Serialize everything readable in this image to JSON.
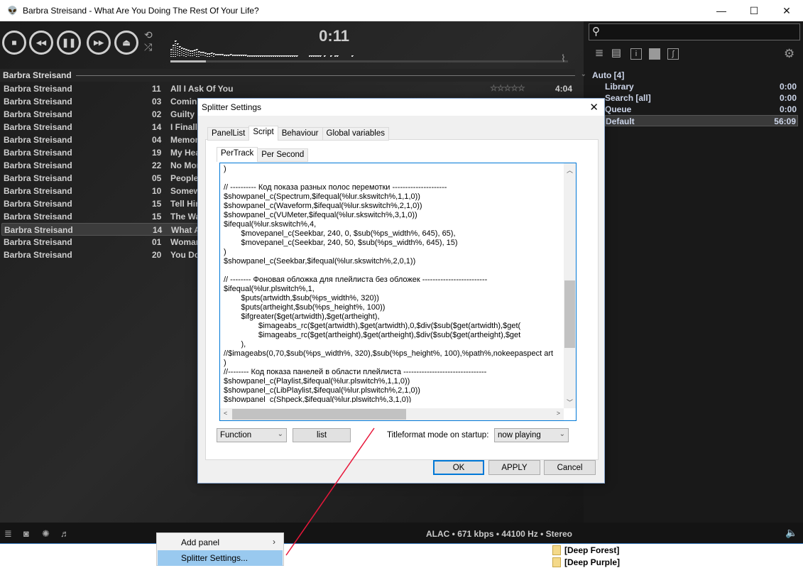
{
  "window": {
    "title": "Barbra Streisand - What Are You Doing The Rest Of Your Life?",
    "minimize": "—",
    "maximize": "☐",
    "close": "✕"
  },
  "transport": {
    "stop": "■",
    "prev": "◀◀",
    "pause": "❚❚",
    "next": "▶▶",
    "eject": "⏏",
    "repeat": "⟲",
    "shuffle": "⤮",
    "time": "0:11",
    "seek_progress": 0.09
  },
  "playlist": {
    "group": "Barbra Streisand",
    "rows": [
      {
        "artist": "Barbra Streisand",
        "num": "11",
        "title": "All I Ask Of You",
        "rating": "☆☆☆☆☆",
        "duration": "4:04"
      },
      {
        "artist": "Barbra Streisand",
        "num": "03",
        "title": "Comin'"
      },
      {
        "artist": "Barbra Streisand",
        "num": "02",
        "title": "Guilty ("
      },
      {
        "artist": "Barbra Streisand",
        "num": "14",
        "title": "I Finall"
      },
      {
        "artist": "Barbra Streisand",
        "num": "04",
        "title": "Memor"
      },
      {
        "artist": "Barbra Streisand",
        "num": "19",
        "title": "My Hea"
      },
      {
        "artist": "Barbra Streisand",
        "num": "22",
        "title": "No Mor"
      },
      {
        "artist": "Barbra Streisand",
        "num": "05",
        "title": "People"
      },
      {
        "artist": "Barbra Streisand",
        "num": "10",
        "title": "Somew"
      },
      {
        "artist": "Barbra Streisand",
        "num": "15",
        "title": "Tell Hir"
      },
      {
        "artist": "Barbra Streisand",
        "num": "15",
        "title": "The Wa"
      },
      {
        "artist": "Barbra Streisand",
        "num": "14",
        "title": "What A"
      },
      {
        "artist": "Barbra Streisand",
        "num": "01",
        "title": "Woman"
      },
      {
        "artist": "Barbra Streisand",
        "num": "20",
        "title": "You Do"
      }
    ]
  },
  "right_panel": {
    "search_icon": "⚲",
    "tree_root": "Auto [4]",
    "items": [
      {
        "name": "Library",
        "time": "0:00"
      },
      {
        "name": "Search [all]",
        "time": "0:00"
      },
      {
        "name": "Queue",
        "time": "0:00"
      },
      {
        "name": "Default",
        "time": "56:09"
      }
    ]
  },
  "statusbar": {
    "text": "ALAC • 671 kbps • 44100 Hz • Stereo"
  },
  "folders": [
    "[Deep Forest]",
    "[Deep Purple]"
  ],
  "dialog": {
    "title": "Splitter Settings",
    "tabs": [
      "PanelList",
      "Script",
      "Behaviour",
      "Global variables"
    ],
    "inner_tabs": [
      "PerTrack",
      "Per Second"
    ],
    "code": ")\n\n// ---------- Код показа разных полос перемотки ---------------------\n$showpanel_c(Spectrum,$ifequal(%lur.skswitch%,1,1,0))\n$showpanel_c(Waveform,$ifequal(%lur.skswitch%,2,1,0))\n$showpanel_c(VUMeter,$ifequal(%lur.skswitch%,3,1,0))\n$ifequal(%lur.skswitch%,4,\n\t$movepanel_c(Seekbar, 240, 0, $sub(%ps_width%, 645), 65),\n\t$movepanel_c(Seekbar, 240, 50, $sub(%ps_width%, 645), 15)\n)\n$showpanel_c(Seekbar,$ifequal(%lur.skswitch%,2,0,1))\n\n// -------- Фоновая обложка для плейлиста без обложек -------------------------\n$ifequal(%lur.plswitch%,1,\n\t$puts(artwidth,$sub(%ps_width%, 320))\n\t$puts(artheight,$sub(%ps_height%, 100))\n\t$ifgreater($get(artwidth),$get(artheight),\n\t\t$imageabs_rc($get(artwidth),$get(artwidth),0,$div($sub($get(artwidth),$get(\n\t\t$imageabs_rc($get(artheight),$get(artheight),$div($sub($get(artheight),$get\n\t),\n//$imageabs(0,70,$sub(%ps_width%, 320),$sub(%ps_height%, 100),%path%,nokeepaspect art\n)\n//-------- Код показа панелей в области плейлиста --------------------------------\n$showpanel_c(Playlist,$ifequal(%lur.plswitch%,1,1,0))\n$showpanel_c(LibPlaylist,$ifequal(%lur.plswitch%,2,1,0))\n$showpanel_c(Shpeck,$ifequal(%lur.plswitch%,3,1,0))",
    "function_combo": "Function",
    "list_button": "list",
    "startup_label": "Titleformat mode on startup:",
    "startup_combo": "now playing",
    "ok": "OK",
    "apply": "APPLY",
    "cancel": "Cancel"
  },
  "context_menu": {
    "items": [
      "Add panel",
      "Splitter Settings..."
    ],
    "submenu_arrow": "›"
  }
}
